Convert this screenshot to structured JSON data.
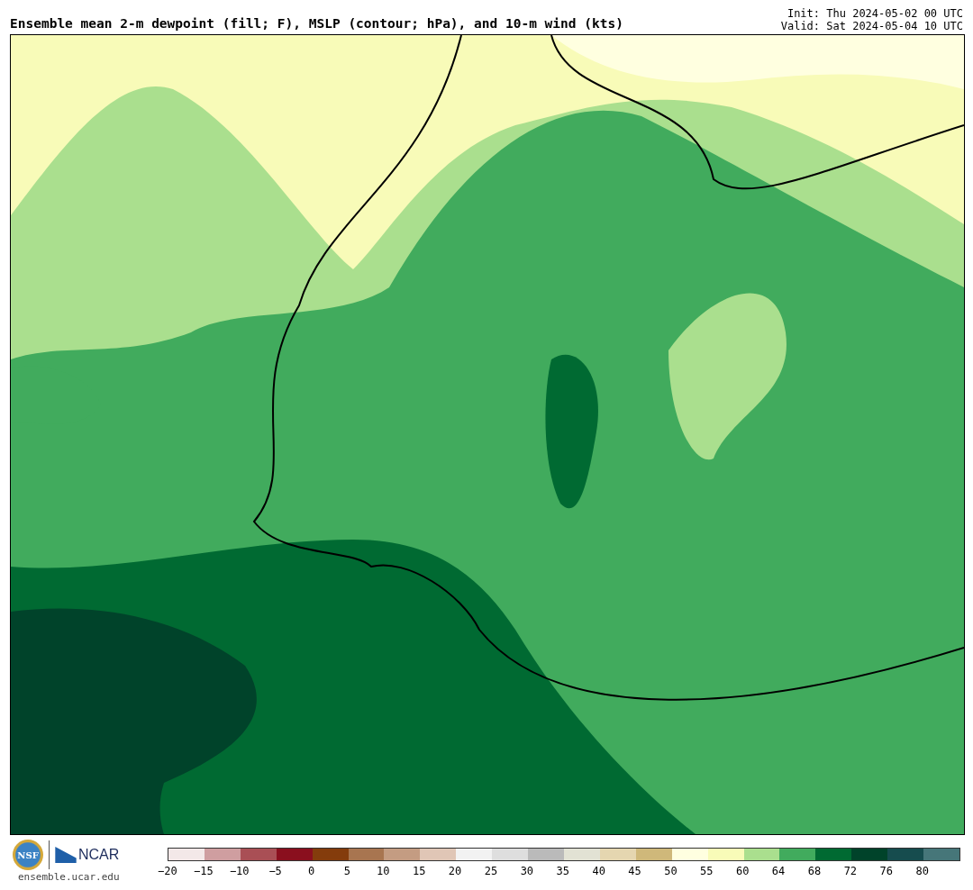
{
  "header": {
    "title": "Ensemble mean 2-m dewpoint (fill; F), MSLP (contour; hPa), and 10-m wind (kts)",
    "init": "Init: Thu 2024-05-02 00 UTC",
    "valid": "Valid: Sat 2024-05-04 10 UTC"
  },
  "footer": {
    "nsf_logo": "NSF",
    "ncar_logo": "NCAR",
    "url": "ensemble.ucar.edu"
  },
  "colorbar": {
    "segments": [
      {
        "color": "#f3e8e8"
      },
      {
        "color": "#cf9ea0"
      },
      {
        "color": "#a94f55"
      },
      {
        "color": "#8a0f1e"
      },
      {
        "color": "#843c0c"
      },
      {
        "color": "#a87550"
      },
      {
        "color": "#c49c82"
      },
      {
        "color": "#e0c6b6"
      },
      {
        "color": "#f2f2f2"
      },
      {
        "color": "#dedede"
      },
      {
        "color": "#bababa"
      },
      {
        "color": "#e2e2d4"
      },
      {
        "color": "#e5d6b0"
      },
      {
        "color": "#cfb87a"
      },
      {
        "color": "#ffffe0"
      },
      {
        "color": "#f8fbb8"
      },
      {
        "color": "#aadf8e"
      },
      {
        "color": "#41ab5d"
      },
      {
        "color": "#006a32"
      },
      {
        "color": "#00432a"
      },
      {
        "color": "#164c4e"
      },
      {
        "color": "#467679"
      }
    ],
    "ticks": [
      "−20",
      "−15",
      "−10",
      "−5",
      "0",
      "5",
      "10",
      "15",
      "20",
      "25",
      "30",
      "35",
      "40",
      "45",
      "50",
      "55",
      "60",
      "64",
      "68",
      "72",
      "76",
      "80"
    ]
  }
}
